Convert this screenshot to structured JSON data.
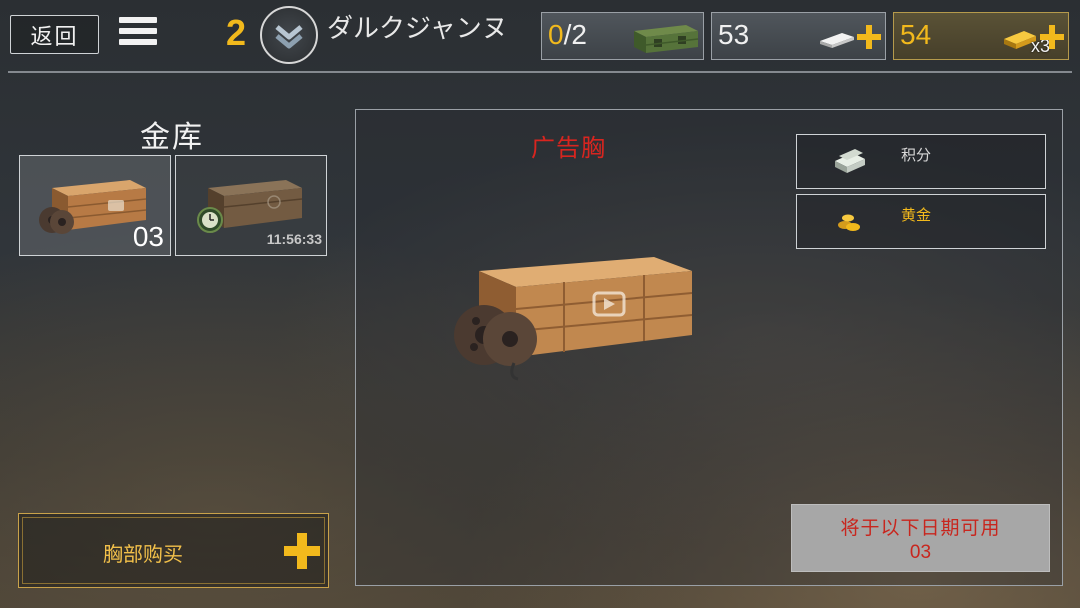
{
  "topbar": {
    "back_label": "返回",
    "rank_level": "2",
    "player_name": "ダルクジャンヌ",
    "crates": {
      "current": "0",
      "total": "/2",
      "icon": "ammo-crate-icon"
    },
    "silver": {
      "value": "53",
      "icon": "silver-bar-icon"
    },
    "gold": {
      "value": "54",
      "multiplier": "x3",
      "icon": "gold-bar-icon"
    }
  },
  "vault": {
    "title": "金库",
    "slots": [
      {
        "count": "03",
        "icon": "ad-crate-icon"
      },
      {
        "timer": "11:56:33",
        "icon": "timed-crate-icon"
      }
    ],
    "buy_label": "胸部购买"
  },
  "detail": {
    "title": "广告胸",
    "rewards": [
      {
        "label": "积分",
        "icon": "cash-stack-icon"
      },
      {
        "label": "黄金",
        "icon": "gold-coins-icon"
      }
    ],
    "available_label": "将于以下日期可用",
    "available_count": "03"
  },
  "colors": {
    "accent_gold": "#f2b91c",
    "title_red": "#d8251f",
    "border_gray": "#9aa0a6"
  }
}
